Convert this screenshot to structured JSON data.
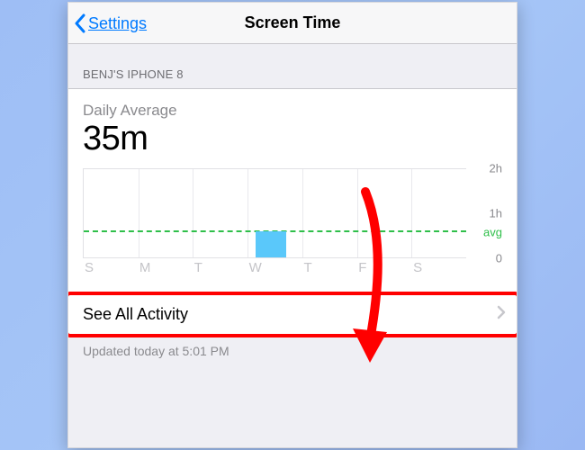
{
  "nav": {
    "back_label": "Settings",
    "title": "Screen Time"
  },
  "section_header": "BENJ'S IPHONE 8",
  "daily_average": {
    "label": "Daily Average",
    "value": "35m"
  },
  "chart_data": {
    "type": "bar",
    "categories": [
      "S",
      "M",
      "T",
      "W",
      "T",
      "F",
      "S"
    ],
    "values": [
      0,
      0,
      0,
      35,
      0,
      0,
      0
    ],
    "ylim": [
      0,
      120
    ],
    "yticks": [
      0,
      60,
      120
    ],
    "ytick_labels": [
      "0",
      "1h",
      "2h"
    ],
    "avg_value": 35,
    "avg_label": "avg",
    "ylabel": "",
    "xlabel": "",
    "title": ""
  },
  "activity_row": {
    "label": "See All Activity"
  },
  "footer": {
    "updated": "Updated today at 5:01 PM"
  },
  "colors": {
    "accent_blue": "#007aff",
    "bar_blue": "#5ac8fa",
    "avg_green": "#2fbf4a",
    "highlight_red": "#ff0000"
  }
}
